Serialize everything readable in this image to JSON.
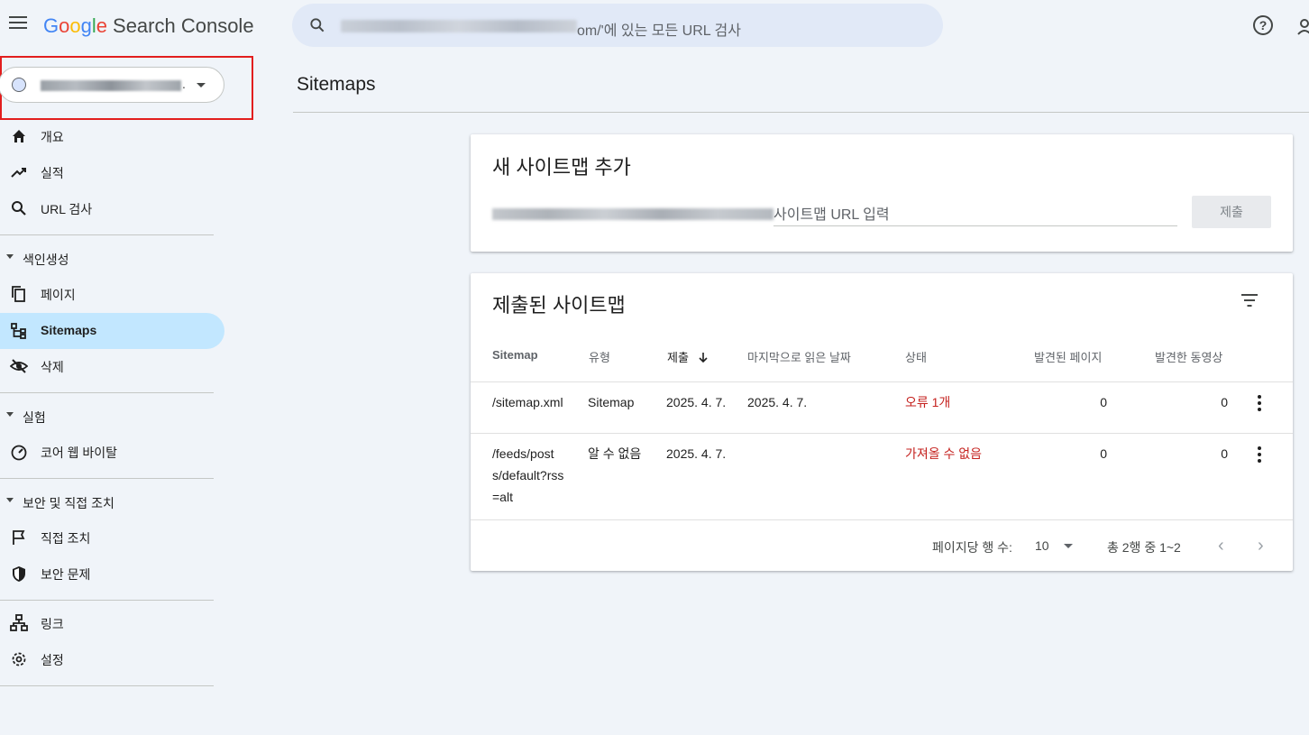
{
  "header": {
    "product_brand": "Google",
    "product_name": "Search Console",
    "search_placeholder_suffix": "om/'에 있는 모든 URL 검사",
    "help_icon": "?"
  },
  "property": {
    "dots": "."
  },
  "sidebar": {
    "items_top": [
      {
        "label": "개요",
        "icon": "home-icon"
      },
      {
        "label": "실적",
        "icon": "trending-up-icon"
      },
      {
        "label": "URL 검사",
        "icon": "search-icon"
      }
    ],
    "section_indexing": "색인생성",
    "items_indexing": [
      {
        "label": "페이지",
        "icon": "pages-icon"
      },
      {
        "label": "Sitemaps",
        "icon": "sitemap-icon",
        "active": true
      },
      {
        "label": "삭제",
        "icon": "removal-icon"
      }
    ],
    "section_experience": "실험",
    "items_experience": [
      {
        "label": "코어 웹 바이탈",
        "icon": "speed-icon"
      }
    ],
    "section_security": "보안 및 직접 조치",
    "items_security": [
      {
        "label": "직접 조치",
        "icon": "flag-icon"
      },
      {
        "label": "보안 문제",
        "icon": "shield-icon"
      }
    ],
    "items_bottom": [
      {
        "label": "링크",
        "icon": "links-icon"
      },
      {
        "label": "설정",
        "icon": "settings-icon"
      }
    ]
  },
  "main": {
    "page_title": "Sitemaps",
    "add_card": {
      "title": "새 사이트맵 추가",
      "input_placeholder": "사이트맵 URL 입력",
      "submit_label": "제출"
    },
    "submitted_card": {
      "title": "제출된 사이트맵",
      "columns": [
        "Sitemap",
        "유형",
        "제출",
        "마지막으로 읽은 날짜",
        "상태",
        "발견된 페이지",
        "발견한 동영상"
      ],
      "rows": [
        {
          "sitemap": "/sitemap.xml",
          "type": "Sitemap",
          "submitted": "2025. 4. 7.",
          "last_read": "2025. 4. 7.",
          "status": "오류 1개",
          "pages": "0",
          "videos": "0"
        },
        {
          "sitemap_lines": [
            "/feeds/post",
            "s/default?rss",
            "=alt"
          ],
          "type": "알 수 없음",
          "submitted": "2025. 4. 7.",
          "last_read": "",
          "status": "가져올 수 없음",
          "pages": "0",
          "videos": "0"
        }
      ],
      "footer": {
        "rows_per_page_label": "페이지당 행 수:",
        "rows_per_page_value": "10",
        "range_label": "총 2행 중 1~2"
      }
    }
  },
  "colors": {
    "accent_active": "#c2e7ff",
    "error": "#c5221f",
    "highlight_box": "#e21e1e"
  }
}
